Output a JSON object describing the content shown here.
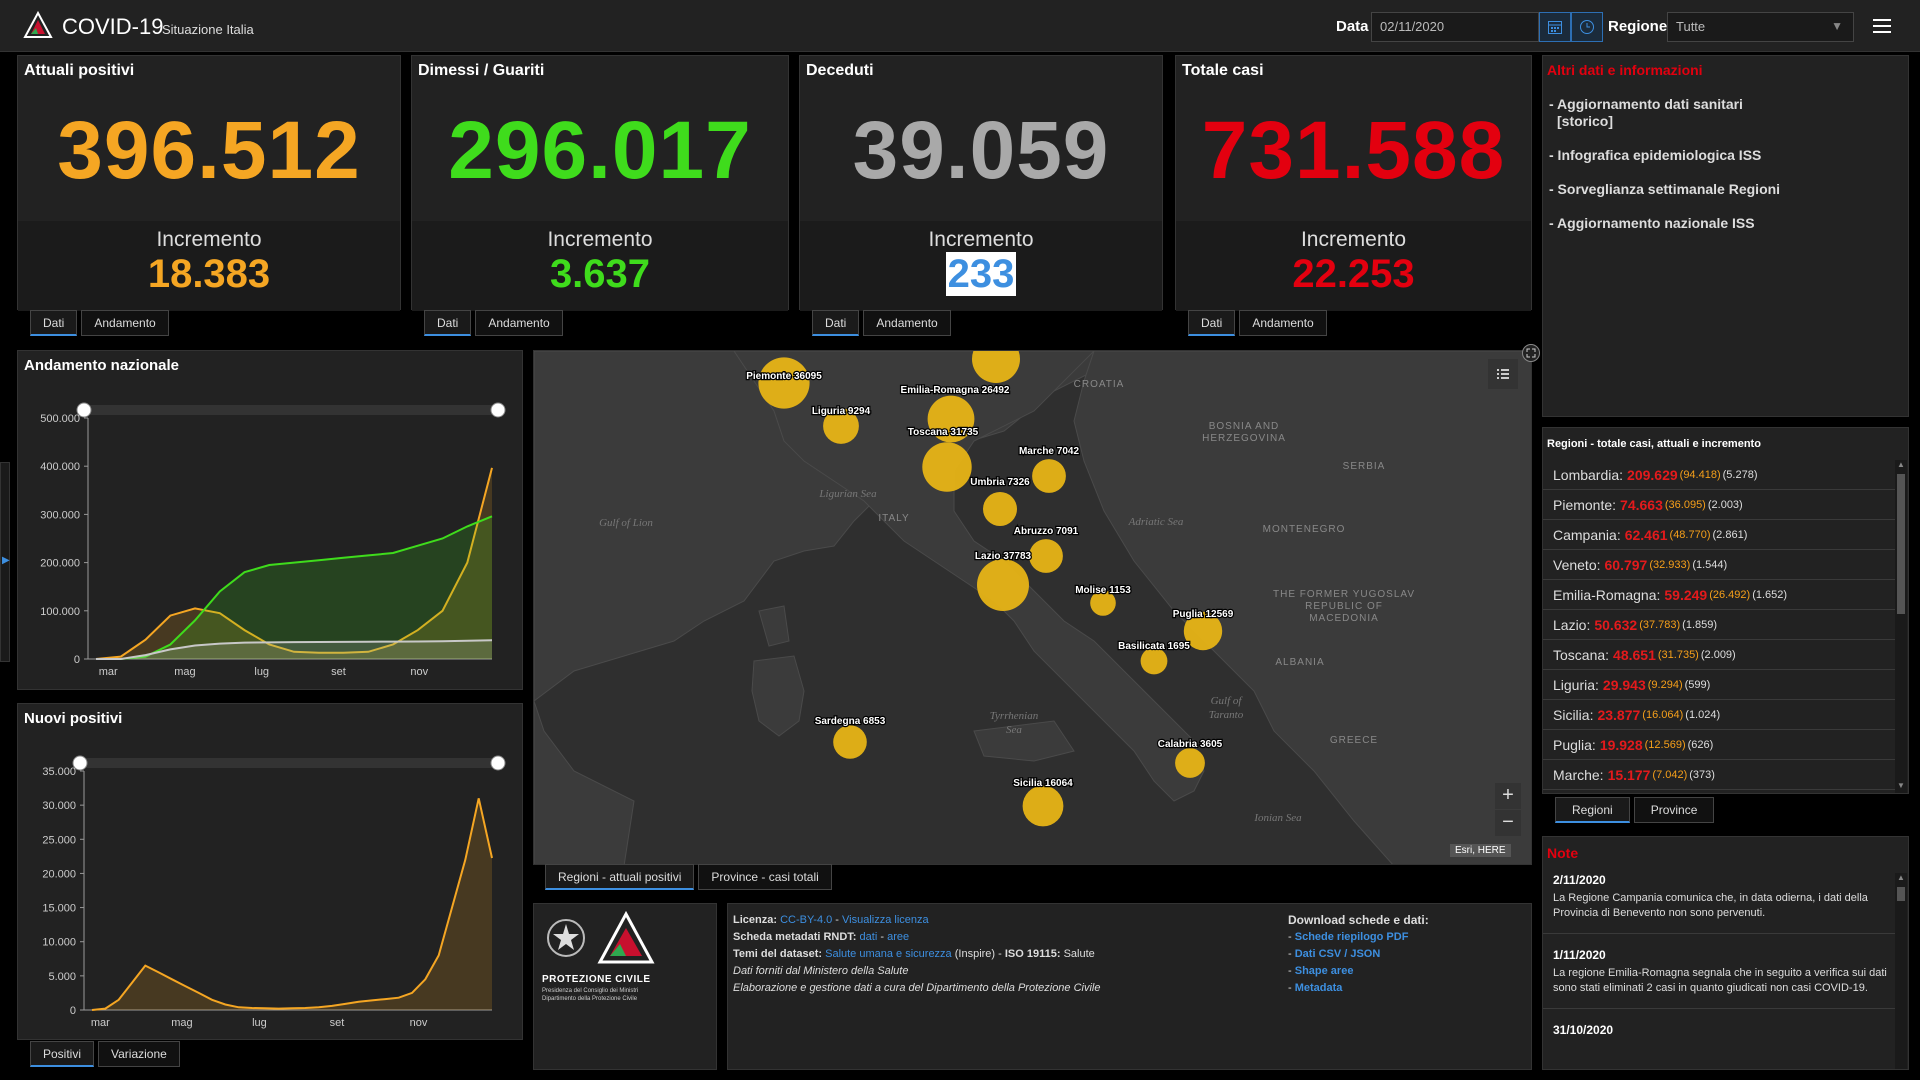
{
  "topbar": {
    "title": "COVID-19",
    "subtitle": "Situazione Italia",
    "date_label": "Data",
    "date_value": "02/11/2020",
    "region_label": "Regione",
    "region_value": "Tutte"
  },
  "cards": [
    {
      "title": "Attuali positivi",
      "value": "396.512",
      "inc_label": "Incremento",
      "inc_value": "18.383",
      "color": "#f5a623"
    },
    {
      "title": "Dimessi / Guariti",
      "value": "296.017",
      "inc_label": "Incremento",
      "inc_value": "3.637",
      "color": "#3fdc1c"
    },
    {
      "title": "Deceduti",
      "value": "39.059",
      "inc_label": "Incremento",
      "inc_value": "233",
      "color": "#a9a9a9"
    },
    {
      "title": "Totale casi",
      "value": "731.588",
      "inc_label": "Incremento",
      "inc_value": "22.253",
      "color": "#e3000f"
    }
  ],
  "card_tabs": {
    "dati": "Dati",
    "andamento": "Andamento"
  },
  "info": {
    "title": "Altri dati e informazioni",
    "links": [
      "- Aggiornamento dati sanitari",
      "[storico]",
      "- Infografica epidemiologica ISS",
      "- Sorveglianza settimanale Regioni",
      "- Aggiornamento nazionale ISS"
    ]
  },
  "regions_panel": {
    "title": "Regioni - totale casi, attuali e incremento",
    "rows": [
      {
        "name": "Lombardia:",
        "total": "209.629",
        "active": "(94.418)",
        "inc": "(5.278)"
      },
      {
        "name": "Piemonte:",
        "total": "74.663",
        "active": "(36.095)",
        "inc": "(2.003)"
      },
      {
        "name": "Campania:",
        "total": "62.461",
        "active": "(48.770)",
        "inc": "(2.861)"
      },
      {
        "name": "Veneto:",
        "total": "60.797",
        "active": "(32.933)",
        "inc": "(1.544)"
      },
      {
        "name": "Emilia-Romagna:",
        "total": "59.249",
        "active": "(26.492)",
        "inc": "(1.652)"
      },
      {
        "name": "Lazio:",
        "total": "50.632",
        "active": "(37.783)",
        "inc": "(1.859)"
      },
      {
        "name": "Toscana:",
        "total": "48.651",
        "active": "(31.735)",
        "inc": "(2.009)"
      },
      {
        "name": "Liguria:",
        "total": "29.943",
        "active": "(9.294)",
        "inc": "(599)"
      },
      {
        "name": "Sicilia:",
        "total": "23.877",
        "active": "(16.064)",
        "inc": "(1.024)"
      },
      {
        "name": "Puglia:",
        "total": "19.928",
        "active": "(12.569)",
        "inc": "(626)"
      },
      {
        "name": "Marche:",
        "total": "15.177",
        "active": "(7.042)",
        "inc": "(373)"
      }
    ],
    "tab_regioni": "Regioni",
    "tab_province": "Province"
  },
  "notes": {
    "title": "Note",
    "items": [
      {
        "date": "2/11/2020",
        "text": "La Regione Campania comunica che, in data odierna, i dati della Provincia di Benevento non sono pervenuti."
      },
      {
        "date": "1/11/2020",
        "text": "La regione Emilia-Romagna segnala che in seguito a verifica sui dati sono stati eliminati 2 casi in quanto giudicati non casi COVID-19."
      },
      {
        "date": "31/10/2020",
        "text": ""
      }
    ]
  },
  "andamento": {
    "title": "Andamento nazionale",
    "tabs": {
      "a": "Positivi",
      "b": "Variazione"
    }
  },
  "nuovi": {
    "title": "Nuovi positivi",
    "tabs": {
      "a": "Positivi",
      "b": "Variazione"
    }
  },
  "chart_data": [
    {
      "type": "line",
      "title": "Andamento nazionale",
      "ylim": [
        0,
        500000
      ],
      "yticks": [
        "500.000",
        "400.000",
        "300.000",
        "200.000",
        "100.000",
        "0"
      ],
      "xticks": [
        "mar",
        "mag",
        "lug",
        "set",
        "nov"
      ],
      "series": [
        {
          "name": "",
          "color": "#f5a623",
          "values": [
            0,
            5000,
            40000,
            90000,
            105000,
            95000,
            60000,
            30000,
            15000,
            13000,
            13000,
            15000,
            30000,
            60000,
            100000,
            200000,
            396512
          ]
        },
        {
          "name": "",
          "color": "#3fdc1c",
          "values": [
            0,
            0,
            5000,
            30000,
            80000,
            140000,
            180000,
            195000,
            200000,
            205000,
            210000,
            215000,
            220000,
            235000,
            250000,
            275000,
            296017
          ]
        },
        {
          "name": "",
          "color": "#c8c8c8",
          "values": [
            0,
            0,
            8000,
            20000,
            28000,
            32000,
            34000,
            34500,
            35000,
            35300,
            35500,
            35800,
            36000,
            36300,
            37000,
            38000,
            39059
          ]
        }
      ]
    },
    {
      "type": "area",
      "title": "Nuovi positivi",
      "ylim": [
        0,
        35000
      ],
      "yticks": [
        "35.000",
        "30.000",
        "25.000",
        "20.000",
        "15.000",
        "10.000",
        "5.000",
        "0"
      ],
      "xticks": [
        "mar",
        "mag",
        "lug",
        "set",
        "nov"
      ],
      "series": [
        {
          "name": "",
          "color": "#f5a623",
          "values": [
            0,
            200,
            1500,
            4000,
            6500,
            5500,
            4500,
            3500,
            2500,
            1500,
            800,
            400,
            300,
            250,
            200,
            250,
            300,
            400,
            600,
            900,
            1200,
            1400,
            1600,
            1800,
            2500,
            4500,
            8000,
            15000,
            22000,
            31000,
            22253
          ]
        }
      ]
    }
  ],
  "map": {
    "tab_a": "Regioni - attuali positivi",
    "tab_b": "Province - casi totali",
    "attribution": "Esri, HERE",
    "geo_labels": [
      "CROATIA",
      "BOSNIA AND",
      "HERZEGOVINA",
      "SERBIA",
      "MONTENEGRO",
      "THE FORMER YUGOSLAV",
      "REPUBLIC OF",
      "MACEDONIA",
      "ALBANIA",
      "GREECE",
      "ITALY"
    ],
    "sea_labels": [
      "Gulf of Lion",
      "Ligurian Sea",
      "Adriatic Sea",
      "Tyrrhenian",
      "Sea",
      "Gulf of",
      "Taranto",
      "Ionian Sea"
    ],
    "bubbles": [
      {
        "label": "Piemonte 36095",
        "value": 36095
      },
      {
        "label": "Liguria 9294",
        "value": 9294
      },
      {
        "label": "Emilia-Romagna 26492",
        "value": 26492
      },
      {
        "label": "Toscana 31735",
        "value": 31735
      },
      {
        "label": "Marche 7042",
        "value": 7042
      },
      {
        "label": "Umbria 7326",
        "value": 7326
      },
      {
        "label": "Abruzzo 7091",
        "value": 7091
      },
      {
        "label": "Lazio 37783",
        "value": 37783
      },
      {
        "label": "Molise 1153",
        "value": 1153
      },
      {
        "label": "Puglia 12569",
        "value": 12569
      },
      {
        "label": "Basilicata 1695",
        "value": 1695
      },
      {
        "label": "Sardegna 6853",
        "value": 6853
      },
      {
        "label": "Calabria 3605",
        "value": 3605
      },
      {
        "label": "Sicilia 16064",
        "value": 16064
      }
    ]
  },
  "footer": {
    "logo_text1": "PROTEZIONE CIVILE",
    "logo_text2": "Presidenza del Consiglio dei Ministri",
    "logo_text3": "Dipartimento della Protezione Civile",
    "lic_label": "Licenza:",
    "lic_val1": "CC-BY-4.0",
    "lic_val2": "Visualizza licenza",
    "meta_label": "Scheda metadati RNDT:",
    "meta_val1": "dati",
    "meta_val2": "aree",
    "temi_label": "Temi del dataset:",
    "temi_val": "Salute umana e sicurezza",
    "temi_rest": "(Inspire) - ",
    "iso_label": "ISO 19115:",
    "iso_val": "Salute",
    "line4": "Dati forniti dal Ministero della Salute",
    "line5": "Elaborazione e gestione dati a cura del Dipartimento della Protezione Civile",
    "dl_title": "Download schede e dati:",
    "dl_links": [
      "Schede riepilogo PDF",
      "Dati CSV / JSON",
      "Shape aree",
      "Metadata"
    ]
  },
  "colors": {
    "active": "#f5a623",
    "recovered": "#3fdc1c",
    "deaths": "#a9a9a9",
    "total": "#e3000f",
    "accent": "#3d8fe0",
    "bubble": "#e7b416"
  }
}
